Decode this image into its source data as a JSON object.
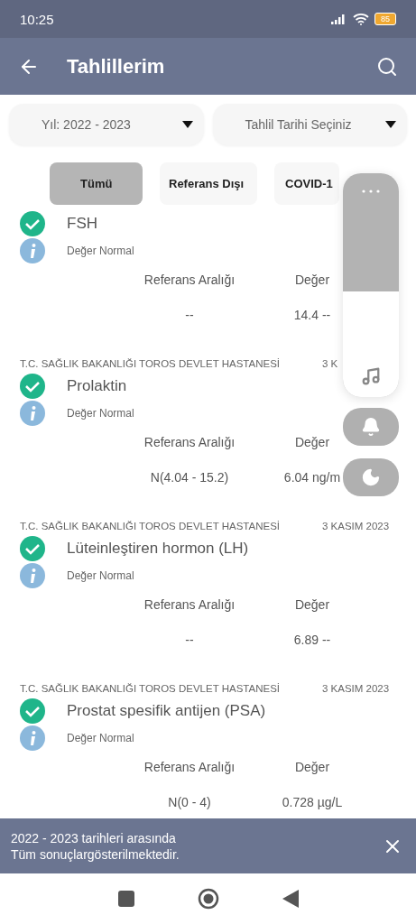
{
  "status_bar": {
    "time": "10:25",
    "battery": "85"
  },
  "app_bar": {
    "title": "Tahlillerim"
  },
  "filters": [
    {
      "label": "Yıl: 2022 - 2023"
    },
    {
      "label": "Tahlil Tarihi Seçiniz"
    }
  ],
  "chips": [
    {
      "label": "Tümü",
      "selected": true
    },
    {
      "label": "Referans Dışı",
      "selected": false
    },
    {
      "label": "COVID-1",
      "selected": false
    }
  ],
  "results": [
    {
      "name": "FSH",
      "status": "Değer Normal",
      "range_label": "Referans Aralığı",
      "value_label": "Değer",
      "range": "--",
      "value": "14.4 --"
    },
    {
      "hospital": "T.C. SAĞLIK BAKANLIĞI TOROS DEVLET HASTANESİ",
      "date": "3 K",
      "name": "Prolaktin",
      "status": "Değer Normal",
      "range_label": "Referans Aralığı",
      "value_label": "Değer",
      "range": "N(4.04 - 15.2)",
      "value": "6.04 ng/m"
    },
    {
      "hospital": "T.C. SAĞLIK BAKANLIĞI TOROS DEVLET HASTANESİ",
      "date": "3 KASIM 2023",
      "name": "Lüteinleştiren hormon (LH)",
      "status": "Değer Normal",
      "range_label": "Referans Aralığı",
      "value_label": "Değer",
      "range": "--",
      "value": "6.89 --"
    },
    {
      "hospital": "T.C. SAĞLIK BAKANLIĞI TOROS DEVLET HASTANESİ",
      "date": "3 KASIM 2023",
      "name": "Prostat spesifik antijen (PSA)",
      "status": "Değer Normal",
      "range_label": "Referans Aralığı",
      "value_label": "Değer",
      "range": "N(0 - 4)",
      "value": "0.728 µg/L"
    }
  ],
  "volume_panel": {
    "level": 0.47
  },
  "banner": {
    "text": "2022 - 2023 tarihleri arasında Tüm sonuçlargösterilmektedir."
  }
}
